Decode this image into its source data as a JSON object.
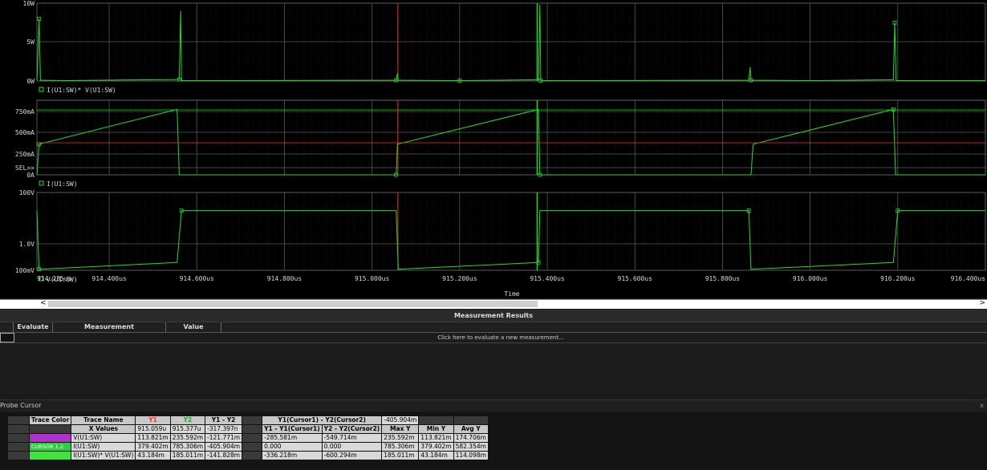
{
  "plot": {
    "panes": [
      {
        "legend_label": "I(U1:SW)* V(U1:SW)",
        "y_ticks": [
          "10W",
          "5W",
          "0W"
        ],
        "trace_color": "#22dd22"
      },
      {
        "legend_label": "I(U1:SW)",
        "y_ticks": [
          "750mA",
          "500mA",
          "250mA",
          "SEL>>",
          "0A"
        ],
        "trace_color": "#22dd22"
      },
      {
        "legend_label": "V(U1:SW)",
        "y_ticks": [
          "100V",
          "1.0V",
          "100mV"
        ],
        "trace_color": "#22dd22"
      }
    ],
    "x_ticks": [
      "914.235us",
      "914.400us",
      "914.600us",
      "914.800us",
      "915.000us",
      "915.200us",
      "915.400us",
      "915.600us",
      "915.800us",
      "916.000us",
      "916.200us",
      "916.400us"
    ],
    "x_label": "Time",
    "cursor1_color": "#ff2a2a",
    "cursor2_color": "#22dd22",
    "chart_data": [
      {
        "type": "line",
        "series": [
          {
            "name": "I(U1:SW)* V(U1:SW)",
            "x": [
              914.235,
              914.24,
              914.243,
              914.3,
              914.56,
              914.563,
              914.565,
              915.055,
              915.058,
              915.06,
              915.2,
              915.38,
              915.383,
              915.385,
              915.86,
              915.863,
              915.865,
              916.0,
              916.19,
              916.193,
              916.196,
              916.4
            ],
            "y": [
              0.1,
              8.0,
              0.1,
              0.05,
              0.2,
              9.0,
              0.05,
              0.1,
              1.0,
              0.1,
              0.05,
              0.15,
              9.8,
              0.05,
              0.1,
              1.8,
              0.1,
              0.05,
              0.15,
              7.5,
              0.05,
              0.05
            ]
          }
        ],
        "ylim": [
          0,
          10
        ]
      },
      {
        "type": "line",
        "series": [
          {
            "name": "I(U1:SW)",
            "x": [
              914.235,
              914.24,
              914.555,
              914.56,
              915.055,
              915.058,
              915.38,
              915.383,
              915.865,
              915.87,
              916.19,
              916.195,
              916.4
            ],
            "y": [
              0.0,
              0.37,
              0.79,
              0.0,
              0.0,
              0.37,
              0.79,
              0.0,
              0.0,
              0.37,
              0.79,
              0.0,
              0.0
            ]
          }
        ],
        "ylim": [
          0,
          0.9
        ]
      },
      {
        "type": "line",
        "series": [
          {
            "name": "V(U1:SW)",
            "x": [
              914.235,
              914.24,
              914.555,
              914.56,
              914.565,
              915.055,
              915.06,
              915.38,
              915.383,
              915.385,
              915.86,
              915.865,
              916.19,
              916.2,
              916.4
            ],
            "y": [
              20,
              0.11,
              0.2,
              2,
              20,
              20,
              0.11,
              0.2,
              20,
              20,
              20,
              0.11,
              0.2,
              20,
              20
            ]
          }
        ],
        "ylim": [
          0.1,
          100
        ],
        "y_scale": "log"
      }
    ]
  },
  "scrollbar": {
    "left_arrow": "<",
    "right_arrow": ">"
  },
  "measurements": {
    "title": "Measurement Results",
    "columns": [
      "Evaluate",
      "Measurement",
      "Value"
    ],
    "hint": "Click here to evaluate a new measurement..."
  },
  "probe": {
    "title": "Probe Cursor",
    "close": "x",
    "headers": [
      "Trace Color",
      "Trace Name",
      "Y1",
      "Y2",
      "Y1 - Y2",
      "Y1(Cursor1) - Y2(Cursor2)",
      "-405.904m"
    ],
    "subheaders": [
      "X Values",
      "915.059u",
      "915.377u",
      "-317.397n",
      "Y1 - Y1(Cursor1)",
      "Y2 - Y2(Cursor2)",
      "Max Y",
      "Min Y",
      "Avg Y"
    ],
    "rows": [
      {
        "color": "#b030d0",
        "color_label": "",
        "name": "V(U1:SW)",
        "y1": "113.821m",
        "y2": "235.592m",
        "diff": "-121.771m",
        "d1": "-285.581m",
        "d2": "-549.714m",
        "max": "235.592m",
        "min": "113.821m",
        "avg": "174.706m"
      },
      {
        "color": "#2ecc40",
        "color_label": "CURSOR 1,2",
        "name": "I(U1:SW)",
        "y1": "379.402m",
        "y2": "785.306m",
        "diff": "-405.904m",
        "d1": "0.000",
        "d2": "0.000",
        "max": "785.306m",
        "min": "379.402m",
        "avg": "582.354m"
      },
      {
        "color": "#39e639",
        "color_label": "",
        "name": "I(U1:SW)* V(U1:SW)",
        "y1": "43.184m",
        "y2": "185.011m",
        "diff": "-141.828m",
        "d1": "-336.218m",
        "d2": "-600.294m",
        "max": "185.011m",
        "min": "43.184m",
        "avg": "114.098m"
      }
    ],
    "y1_color": "#ff2a2a",
    "y2_color": "#22dd22"
  }
}
